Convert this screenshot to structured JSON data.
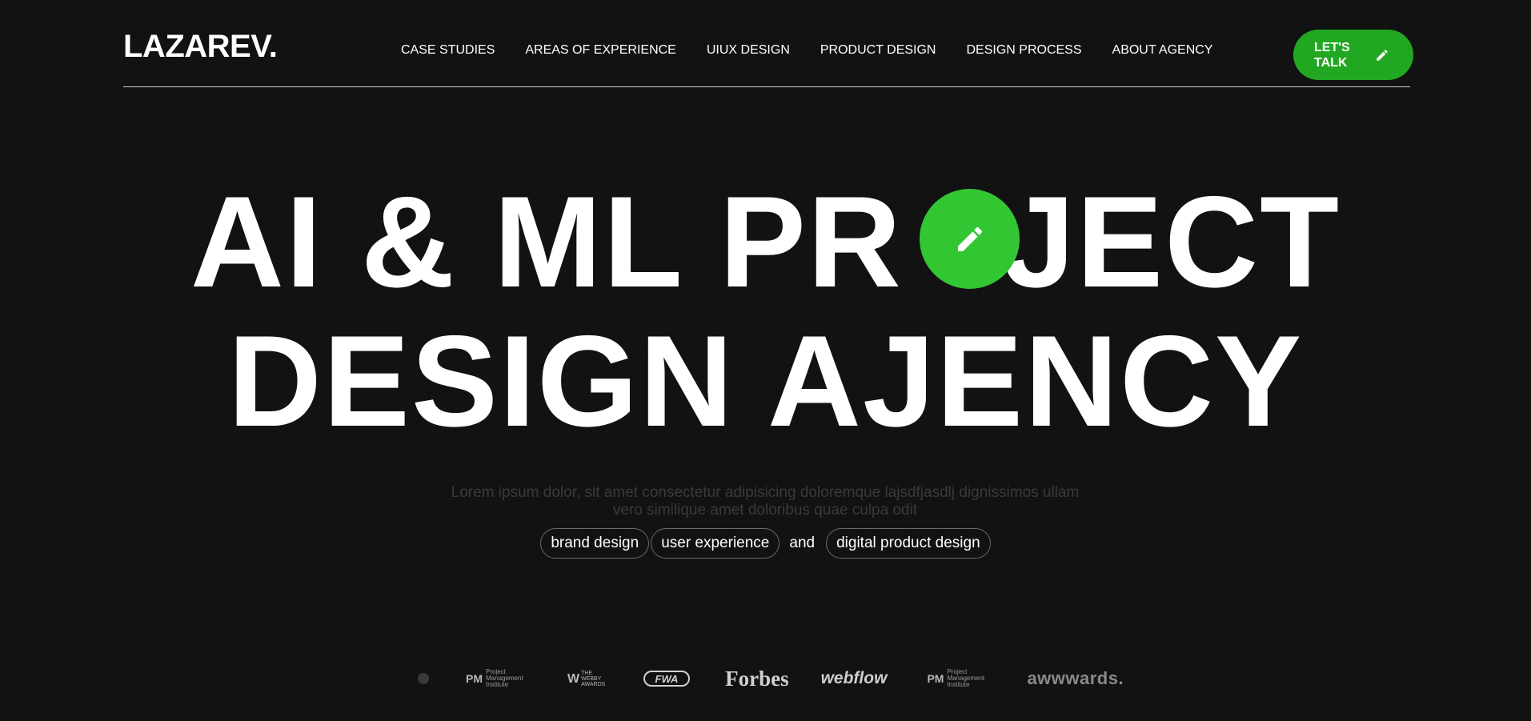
{
  "header": {
    "logo": "LAZAREV.",
    "nav": [
      "CASE STUDIES",
      "AREAS OF EXPERIENCE",
      "UIUX DESIGN",
      "PRODUCT DESIGN",
      "DESIGN PROCESS",
      "ABOUT AGENCY"
    ],
    "cta_label": "LET'S\nTALK",
    "cta_icon": "pencil-icon"
  },
  "hero": {
    "line1_before": "AI & ML PR",
    "line1_after": "JECT",
    "line2": "DESIGN AJENCY",
    "badge_icon": "pencil-icon"
  },
  "description": "Lorem ipsum dolor, sit amet consectetur adipisicing doloremque lajsdfjasdlj dignissimos ullam vero similique amet doloribus quae culpa odit",
  "tags": {
    "items": [
      "brand design",
      "user experience",
      "digital product design"
    ],
    "conjunction": "and"
  },
  "logos": {
    "pmi_mark": "PM",
    "pmi_text": "Project Management Institute",
    "webby_mark": "W",
    "webby_text": "THE WEBBY AWARDS",
    "fwa": "FWA",
    "forbes": "Forbes",
    "webflow": "webflow",
    "awwwards": "awwwards."
  },
  "colors": {
    "background": "#121212",
    "accent": "#22a722",
    "accent_bright": "#33c633"
  }
}
